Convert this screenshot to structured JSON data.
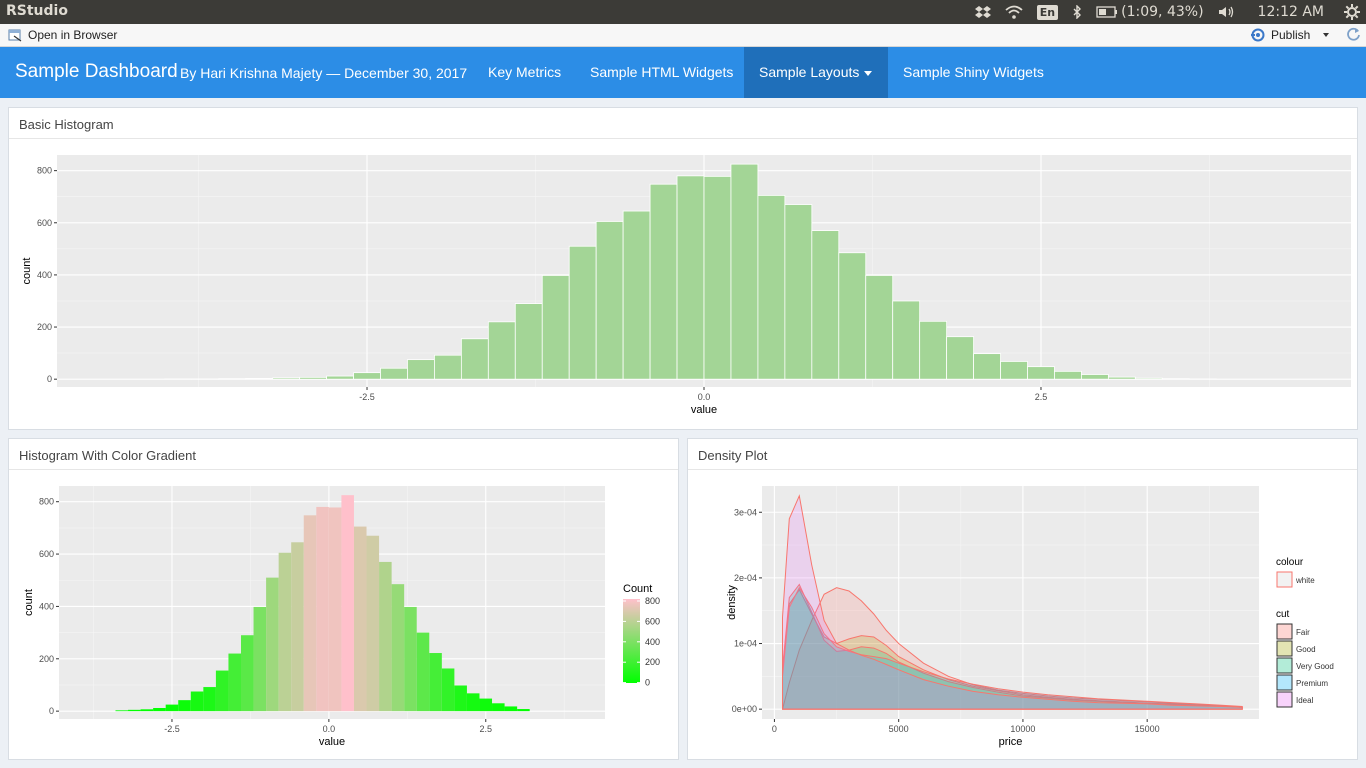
{
  "os": {
    "app_name": "RStudio",
    "language": "En",
    "battery": "(1:09, 43%)",
    "time": "12:12 AM",
    "icons": [
      "dropbox-icon",
      "wifi-icon",
      "bluetooth-icon",
      "battery-icon",
      "volume-icon",
      "settings-gear-icon"
    ]
  },
  "viewer": {
    "open_browser": "Open in Browser",
    "publish": "Publish"
  },
  "navbar": {
    "brand": "Sample Dashboard",
    "author": "By Hari Krishna Majety — December 30, 2017",
    "items": [
      {
        "label": "Key Metrics",
        "active": false
      },
      {
        "label": "Sample HTML Widgets",
        "active": false
      },
      {
        "label": "Sample Layouts",
        "active": true,
        "dropdown": true
      },
      {
        "label": "Sample Shiny Widgets",
        "active": false
      }
    ],
    "color": "#2c8de6",
    "active_color": "#1f6fba"
  },
  "panels": {
    "basic": {
      "title": "Basic Histogram"
    },
    "gradient": {
      "title": "Histogram With Color Gradient"
    },
    "density": {
      "title": "Density Plot"
    }
  },
  "chart_data": [
    {
      "type": "bar",
      "title": "Basic Histogram",
      "xlabel": "value",
      "ylabel": "count",
      "xlim": [
        -4.8,
        4.8
      ],
      "ylim": [
        -30,
        860
      ],
      "xticks": [
        -2.5,
        0.0,
        2.5
      ],
      "xtick_labels": [
        "-2.5",
        "0.0",
        "2.5"
      ],
      "yticks": [
        0,
        200,
        400,
        600,
        800
      ],
      "ytick_labels": [
        "0",
        "200",
        "400",
        "600",
        "800"
      ],
      "bin_width": 0.2,
      "bin_centers": [
        -3.9,
        -3.7,
        -3.5,
        -3.3,
        -3.1,
        -2.9,
        -2.7,
        -2.5,
        -2.3,
        -2.1,
        -1.9,
        -1.7,
        -1.5,
        -1.3,
        -1.1,
        -0.9,
        -0.7,
        -0.5,
        -0.3,
        -0.1,
        0.1,
        0.3,
        0.5,
        0.7,
        0.9,
        1.1,
        1.3,
        1.5,
        1.7,
        1.9,
        2.1,
        2.3,
        2.5,
        2.7,
        2.9,
        3.1,
        3.3,
        3.5,
        3.7
      ],
      "values": [
        1,
        1,
        2,
        3,
        5,
        7,
        12,
        25,
        42,
        75,
        92,
        155,
        220,
        290,
        398,
        510,
        605,
        645,
        748,
        780,
        778,
        825,
        705,
        670,
        570,
        485,
        398,
        300,
        222,
        163,
        98,
        68,
        48,
        30,
        18,
        8,
        4,
        2,
        1
      ],
      "fill": "#a3d596",
      "grid": true
    },
    {
      "type": "bar",
      "title": "Histogram With Color Gradient",
      "xlabel": "value",
      "ylabel": "count",
      "xlim": [
        -4.3,
        4.4
      ],
      "ylim": [
        -30,
        860
      ],
      "xticks": [
        -2.5,
        0.0,
        2.5
      ],
      "xtick_labels": [
        "-2.5",
        "0.0",
        "2.5"
      ],
      "yticks": [
        0,
        200,
        400,
        600,
        800
      ],
      "ytick_labels": [
        "0",
        "200",
        "400",
        "600",
        "800"
      ],
      "bin_width": 0.2,
      "bin_centers": [
        -3.3,
        -3.1,
        -2.9,
        -2.7,
        -2.5,
        -2.3,
        -2.1,
        -1.9,
        -1.7,
        -1.5,
        -1.3,
        -1.1,
        -0.9,
        -0.7,
        -0.5,
        -0.3,
        -0.1,
        0.1,
        0.3,
        0.5,
        0.7,
        0.9,
        1.1,
        1.3,
        1.5,
        1.7,
        1.9,
        2.1,
        2.3,
        2.5,
        2.7,
        2.9,
        3.1
      ],
      "values": [
        3,
        5,
        7,
        12,
        25,
        42,
        75,
        92,
        155,
        220,
        290,
        398,
        510,
        605,
        645,
        748,
        780,
        778,
        825,
        705,
        670,
        570,
        485,
        398,
        300,
        222,
        163,
        98,
        68,
        48,
        30,
        18,
        8
      ],
      "gradient_low": "#00ff00",
      "gradient_high": "#ffc0cb",
      "legend_title": "Count",
      "legend_ticks": [
        "800",
        "600",
        "400",
        "200",
        "0"
      ],
      "legend_placement": "right",
      "grid": true
    },
    {
      "type": "area",
      "title": "Density Plot",
      "xlabel": "price",
      "ylabel": "density",
      "xlim": [
        -500,
        19500
      ],
      "ylim": [
        -1.5e-05,
        0.00034
      ],
      "xticks": [
        0,
        5000,
        10000,
        15000
      ],
      "xtick_labels": [
        "0",
        "5000",
        "10000",
        "15000"
      ],
      "yticks": [
        0,
        0.0001,
        0.0002,
        0.0003
      ],
      "ytick_labels": [
        "0e+00",
        "1e-04",
        "2e-04",
        "3e-04"
      ],
      "x": [
        326,
        600,
        1000,
        1500,
        2000,
        2500,
        3000,
        3500,
        4000,
        4500,
        5000,
        6000,
        7000,
        8000,
        9000,
        10000,
        11000,
        12000,
        13000,
        14000,
        15000,
        16000,
        17000,
        18000,
        18823
      ],
      "series": [
        {
          "name": "Fair",
          "fill": "#f8766d",
          "values": [
            0.0,
            4e-05,
            9e-05,
            0.000135,
            0.000175,
            0.000185,
            0.00018,
            0.000165,
            0.000145,
            0.00012,
            0.0001,
            7e-05,
            5e-05,
            3.7e-05,
            2.9e-05,
            2.4e-05,
            2e-05,
            1.7e-05,
            1.5e-05,
            1.3e-05,
            1.1e-05,
            9e-06,
            7e-06,
            5e-06,
            3e-06
          ]
        },
        {
          "name": "Good",
          "fill": "#a3a500",
          "values": [
            6.2e-05,
            0.00016,
            0.000182,
            0.000145,
            0.00011,
            0.0001,
            0.000107,
            0.000112,
            0.00011,
            9.7e-05,
            8e-05,
            6e-05,
            4.5e-05,
            3.5e-05,
            2.8e-05,
            2.2e-05,
            1.8e-05,
            1.5e-05,
            1.3e-05,
            1.1e-05,
            9e-06,
            8e-06,
            6e-06,
            5e-06,
            3e-06
          ]
        },
        {
          "name": "Very Good",
          "fill": "#00bf7d",
          "values": [
            6.2e-05,
            0.00017,
            0.00019,
            0.000148,
            0.000105,
            8.8e-05,
            9e-05,
            9.5e-05,
            9.3e-05,
            8.5e-05,
            7.2e-05,
            5.5e-05,
            4.2e-05,
            3.3e-05,
            2.6e-05,
            2e-05,
            1.7e-05,
            1.4e-05,
            1.2e-05,
            1e-05,
            9e-06,
            7e-06,
            6e-06,
            5e-06,
            3e-06
          ]
        },
        {
          "name": "Premium",
          "fill": "#00b0f6",
          "values": [
            5e-05,
            0.000155,
            0.000185,
            0.000155,
            0.000115,
            9.5e-05,
            8.8e-05,
            8.3e-05,
            8e-05,
            7.7e-05,
            7e-05,
            5.7e-05,
            4.6e-05,
            3.8e-05,
            3.1e-05,
            2.6e-05,
            2.2e-05,
            1.9e-05,
            1.6e-05,
            1.4e-05,
            1.2e-05,
            1e-05,
            8e-06,
            6e-06,
            4e-06
          ]
        },
        {
          "name": "Ideal",
          "fill": "#e76bf3",
          "values": [
            0.00014,
            0.00029,
            0.000325,
            0.00022,
            0.000135,
            0.0001,
            9e-05,
            8.2e-05,
            7.6e-05,
            6.8e-05,
            6e-05,
            4.5e-05,
            3.5e-05,
            2.7e-05,
            2.2e-05,
            1.8e-05,
            1.5e-05,
            1.2e-05,
            1e-05,
            9e-06,
            8e-06,
            6e-06,
            5e-06,
            4e-06,
            3e-06
          ]
        }
      ],
      "outline": "#f8766d",
      "legend_colour_title": "colour",
      "legend_colour_label": "white",
      "legend_cut_title": "cut",
      "legend_placement": "right",
      "grid": true
    }
  ]
}
